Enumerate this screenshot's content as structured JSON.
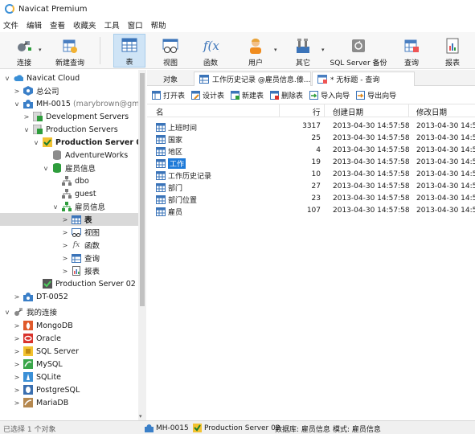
{
  "window": {
    "title": "Navicat Premium"
  },
  "menu": [
    "文件",
    "编辑",
    "查看",
    "收藏夹",
    "工具",
    "窗口",
    "帮助"
  ],
  "toolbar": {
    "items": [
      {
        "label": "连接",
        "icon": "connect-icon"
      },
      {
        "label": "新建查询",
        "icon": "new-query-icon"
      },
      {
        "label": "表",
        "icon": "table-icon"
      },
      {
        "label": "视图",
        "icon": "view-icon"
      },
      {
        "label": "函数",
        "icon": "function-icon"
      },
      {
        "label": "用户",
        "icon": "user-icon"
      },
      {
        "label": "其它",
        "icon": "tools-icon"
      },
      {
        "label": "SQL Server 备份",
        "icon": "backup-icon"
      },
      {
        "label": "查询",
        "icon": "query-icon"
      },
      {
        "label": "报表",
        "icon": "report-icon"
      }
    ]
  },
  "tree": {
    "nodes": [
      {
        "label": "Navicat Cloud",
        "toggle": "v"
      },
      {
        "label": "总公司",
        "toggle": ">"
      },
      {
        "label": "MH-0015",
        "extra": "(marybrown@gmai",
        "toggle": "v"
      },
      {
        "label": "Development Servers",
        "toggle": ">"
      },
      {
        "label": "Production Servers",
        "toggle": "v"
      },
      {
        "label": "Production Server 02",
        "toggle": "v"
      },
      {
        "label": "AdventureWorks",
        "toggle": ""
      },
      {
        "label": "雇员信息",
        "toggle": "v"
      },
      {
        "label": "dbo",
        "toggle": ""
      },
      {
        "label": "guest",
        "toggle": ""
      },
      {
        "label": "雇员信息",
        "toggle": "v"
      },
      {
        "label": "表",
        "toggle": ">"
      },
      {
        "label": "视图",
        "toggle": ">"
      },
      {
        "label": "函数",
        "toggle": ">"
      },
      {
        "label": "查询",
        "toggle": ">"
      },
      {
        "label": "报表",
        "toggle": ">"
      },
      {
        "label": "Production Server 02",
        "toggle": ""
      },
      {
        "label": "DT-0052",
        "toggle": ">"
      },
      {
        "label": "我的连接",
        "toggle": "v"
      },
      {
        "label": "MongoDB",
        "toggle": ">"
      },
      {
        "label": "Oracle",
        "toggle": ">"
      },
      {
        "label": "SQL Server",
        "toggle": ">"
      },
      {
        "label": "MySQL",
        "toggle": ">"
      },
      {
        "label": "SQLite",
        "toggle": ">"
      },
      {
        "label": "PostgreSQL",
        "toggle": ">"
      },
      {
        "label": "MariaDB",
        "toggle": ">"
      }
    ]
  },
  "tabs": {
    "objects": "对象",
    "doc1": "工作历史记录 @雇员信息.傣...",
    "doc2": "* 无标题 - 查询"
  },
  "object_toolbar": [
    "打开表",
    "设计表",
    "新建表",
    "删除表",
    "导入向导",
    "导出向导"
  ],
  "table": {
    "columns": [
      "名",
      "行",
      "创建日期",
      "修改日期"
    ],
    "rows": [
      {
        "name": "上班时间",
        "rows": "3317",
        "created": "2013-04-30 14:57:58",
        "modified": "2013-04-30 14:57:5"
      },
      {
        "name": "国家",
        "rows": "25",
        "created": "2013-04-30 14:57:58",
        "modified": "2013-04-30 14:57:5"
      },
      {
        "name": "地区",
        "rows": "4",
        "created": "2013-04-30 14:57:58",
        "modified": "2013-04-30 14:57:5"
      },
      {
        "name": "工作",
        "rows": "19",
        "created": "2013-04-30 14:57:58",
        "modified": "2013-04-30 14:57:5"
      },
      {
        "name": "工作历史记录",
        "rows": "10",
        "created": "2013-04-30 14:57:58",
        "modified": "2013-04-30 14:57:5"
      },
      {
        "name": "部门",
        "rows": "27",
        "created": "2013-04-30 14:57:58",
        "modified": "2013-04-30 14:57:5"
      },
      {
        "name": "部门位置",
        "rows": "23",
        "created": "2013-04-30 14:57:58",
        "modified": "2013-04-30 14:57:5"
      },
      {
        "name": "雇员",
        "rows": "107",
        "created": "2013-04-30 14:57:58",
        "modified": "2013-04-30 14:57:5"
      }
    ]
  },
  "status": {
    "selected": "已选择 1 个对象",
    "host": "MH-0015",
    "server": "Production Server 02",
    "db": "数据库: 雇员信息",
    "schema": "模式: 雇员信息"
  },
  "colors": {
    "accent": "#1e7ad8",
    "selected_bg": "#cfe4f6",
    "tree_sel": "#d9d9d9"
  }
}
